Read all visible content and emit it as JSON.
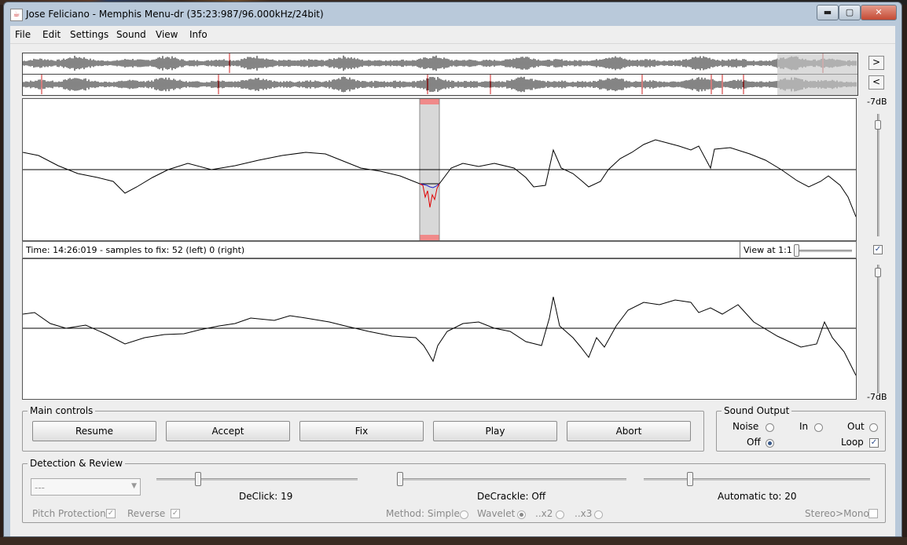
{
  "window": {
    "title": "Jose Feliciano - Memphis Menu-dr (35:23:987/96.000kHz/24bit)",
    "min_label": "▬",
    "max_label": "▢",
    "close_label": "✕"
  },
  "menubar": [
    "File",
    "Edit",
    "Settings",
    "Sound",
    "View",
    "Info"
  ],
  "navigation": {
    "forward": ">",
    "back": "<"
  },
  "scale": {
    "top_db": "-7dB",
    "bottom_db": "-7dB"
  },
  "status": {
    "text": "Time: 14:26:019 - samples to fix: 52 (left) 0 (right)",
    "view_label": "View at 1:1",
    "link_channels_checked": true
  },
  "main_controls": {
    "title": "Main controls",
    "buttons": [
      "Resume",
      "Accept",
      "Fix",
      "Play",
      "Abort"
    ]
  },
  "sound_output": {
    "title": "Sound Output",
    "noise": "Noise",
    "in": "In",
    "out": "Out",
    "off": "Off",
    "loop": "Loop",
    "selected": "Off",
    "loop_checked": true
  },
  "detection": {
    "title": "Detection & Review",
    "preset": "---",
    "declick_label": "DeClick: 19",
    "decrackle_label": "DeCrackle: Off",
    "automatic_label": "Automatic to: 20",
    "declick_value": 19,
    "automatic_value": 20,
    "pitch_protection": "Pitch Protection",
    "reverse": "Reverse",
    "method": "Method: Simple",
    "wavelet": "Wavelet",
    "x2": "..x2",
    "x3": "..x3",
    "stereo_mono": "Stereo>Mono",
    "method_selected": "Wavelet",
    "pitch_protection_checked": true,
    "reverse_checked": true,
    "stereo_mono_checked": false
  },
  "colors": {
    "selection": "#d8d8d8",
    "selection_marker": "#f08a8a",
    "fix_curve": "#e00000",
    "original_curve": "#2020d0",
    "click_markers": "#cc2020"
  }
}
